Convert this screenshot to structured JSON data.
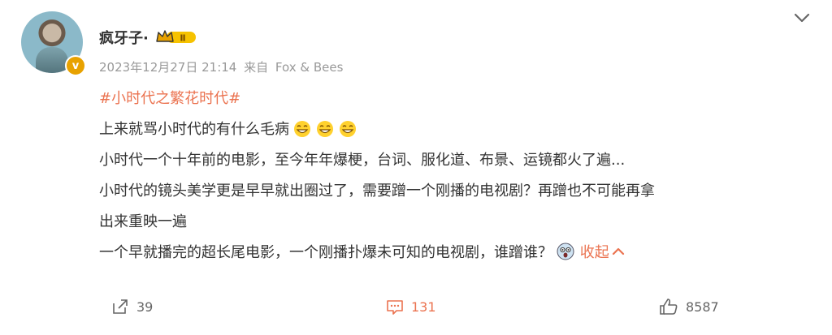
{
  "post": {
    "username": "疯牙子·",
    "rank_badge": "Ⅱ",
    "verified_badge": "v",
    "timestamp": "2023年12月27日 21:14",
    "source_prefix": "来自",
    "source": "Fox & Bees"
  },
  "content": {
    "hashtag": "#小时代之繁花时代#",
    "line1": "上来就骂小时代的有什么毛病",
    "line2": "小时代一个十年前的电影，至今年年爆梗，台词、服化道、布景、运镜都火了遍...",
    "line3": "小时代的镜头美学更是早早就出圈过了，需要蹭一个刚播的电视剧？再蹭也不可能再拿",
    "line4": "出来重映一遍",
    "line5": "一个早就播完的超长尾电影，一个刚播扑爆未可知的电视剧，谁蹭谁？",
    "collapse_label": "收起"
  },
  "footer": {
    "repost_count": "39",
    "comment_count": "131",
    "like_count": "8587"
  },
  "colors": {
    "accent": "#eb7350",
    "meta": "#999999",
    "badge_gold": "#e8a200"
  },
  "icons": [
    "chevron-down-icon",
    "grin-emoji-icon",
    "scared-emoji-icon",
    "repost-icon",
    "comment-icon",
    "like-icon"
  ]
}
